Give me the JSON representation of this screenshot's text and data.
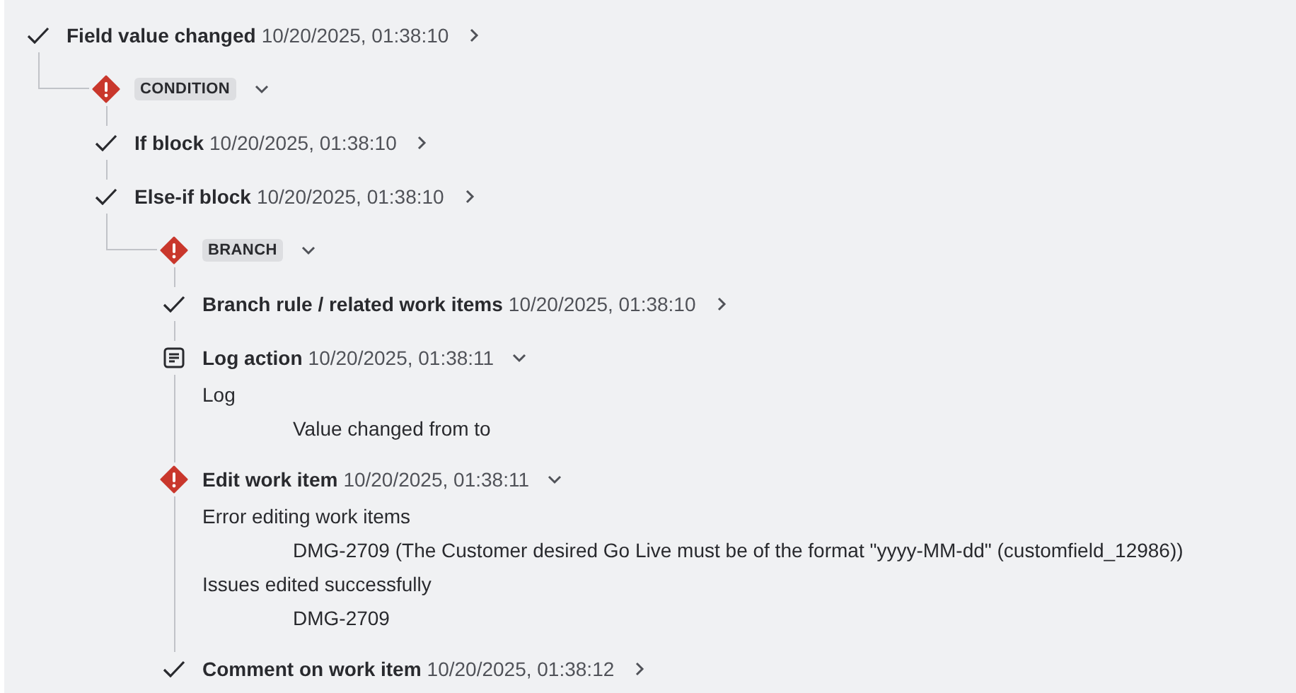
{
  "tree": [
    {
      "kind": "step",
      "failed": false,
      "title": "Field value changed",
      "time": "10/20/2025, 01:38:10",
      "expanded": false,
      "children": [
        {
          "kind": "group",
          "failed": true,
          "tag": "CONDITION",
          "expanded": true,
          "children": [
            {
              "kind": "step",
              "failed": false,
              "title": "If block",
              "time": "10/20/2025, 01:38:10",
              "expanded": false
            },
            {
              "kind": "step",
              "failed": false,
              "title": "Else-if block",
              "time": "10/20/2025, 01:38:10",
              "expanded": false,
              "children": [
                {
                  "kind": "group",
                  "failed": true,
                  "tag": "BRANCH",
                  "expanded": true,
                  "children": [
                    {
                      "kind": "step",
                      "failed": false,
                      "title": "Branch rule / related work items",
                      "time": "10/20/2025, 01:38:10",
                      "expanded": false
                    },
                    {
                      "kind": "log",
                      "title": "Log action",
                      "time": "10/20/2025, 01:38:11",
                      "expanded": true,
                      "details": [
                        {
                          "label": "Log",
                          "values": [
                            "Value changed from to"
                          ]
                        }
                      ]
                    },
                    {
                      "kind": "step",
                      "failed": true,
                      "title": "Edit work item",
                      "time": "10/20/2025, 01:38:11",
                      "expanded": true,
                      "details": [
                        {
                          "label": "Error editing work items",
                          "values": [
                            "DMG-2709 (The Customer desired Go Live must be of the format \"yyyy-MM-dd\" (customfield_12986))"
                          ]
                        },
                        {
                          "label": "Issues edited successfully",
                          "values": [
                            "DMG-2709"
                          ]
                        }
                      ]
                    },
                    {
                      "kind": "step",
                      "failed": false,
                      "title": "Comment on work item",
                      "time": "10/20/2025, 01:38:12",
                      "expanded": false
                    }
                  ]
                }
              ]
            }
          ]
        }
      ]
    }
  ]
}
